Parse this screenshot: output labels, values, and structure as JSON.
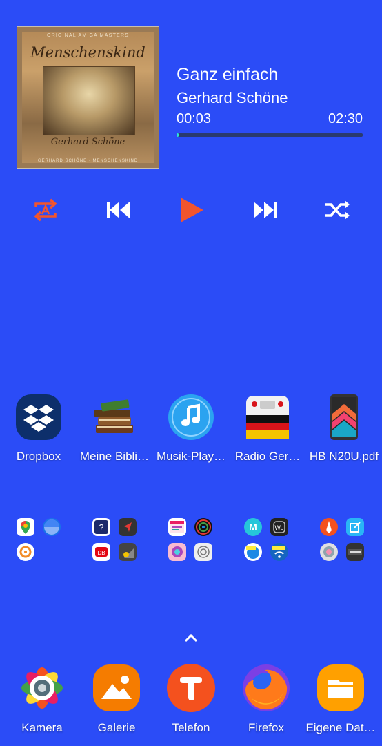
{
  "music": {
    "album": {
      "top_text": "ORIGINAL AMIGA MASTERS",
      "title": "Menschenskind",
      "artist": "Gerhard Schöne",
      "bottom_text": "GERHARD SCHÖNE · MENSCHENSKIND"
    },
    "song_title": "Ganz einfach",
    "artist": "Gerhard Schöne",
    "elapsed": "00:03",
    "duration": "02:30",
    "progress": 0.01,
    "colors": {
      "accent": "#f2552d",
      "progress_fill": "#2ee0d8"
    }
  },
  "apps": [
    {
      "label": "Dropbox",
      "icon": "dropbox-icon"
    },
    {
      "label": "Meine Bibli…",
      "icon": "books-icon"
    },
    {
      "label": "Musik-Play…",
      "icon": "music-note-icon"
    },
    {
      "label": "Radio Ger…",
      "icon": "radio-germany-icon"
    },
    {
      "label": "HB N20U.pdf",
      "icon": "pdf-phone-icon"
    }
  ],
  "folders": [
    {
      "icons": [
        "google-maps-icon",
        "google-earth-icon",
        "orange-location-icon"
      ]
    },
    {
      "icons": [
        "db-info-icon",
        "red-navigation-icon",
        "db-navigator-icon",
        "night-mode-icon"
      ]
    },
    {
      "icons": [
        "calendar-app-icon",
        "mandala-icon",
        "coloring-icon",
        "sketch-icon"
      ]
    },
    {
      "icons": [
        "cyan-m-icon",
        "wu-icon",
        "wifi-app-icon",
        "wifi-signal-icon"
      ]
    },
    {
      "icons": [
        "pencil-app-icon",
        "edit-share-icon",
        "lens-icon",
        "panasonic-icon"
      ]
    }
  ],
  "dock": [
    {
      "label": "Kamera",
      "icon": "camera-icon"
    },
    {
      "label": "Galerie",
      "icon": "gallery-icon"
    },
    {
      "label": "Telefon",
      "icon": "telefon-icon"
    },
    {
      "label": "Firefox",
      "icon": "firefox-icon"
    },
    {
      "label": "Eigene Dat…",
      "icon": "folder-icon"
    }
  ],
  "background_color": "#2b4cf7"
}
